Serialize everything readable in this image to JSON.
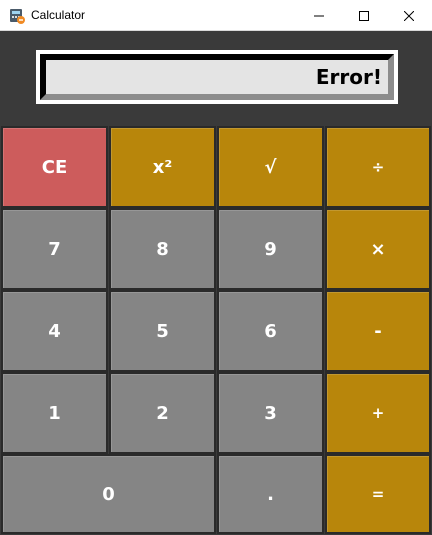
{
  "window": {
    "title": "Calculator",
    "icon": "calculator-app-icon"
  },
  "display": {
    "text": "Error!"
  },
  "colors": {
    "gray": "#858585",
    "gold": "#b8860b",
    "red": "#cd5c5c",
    "background": "#3a3a3a"
  },
  "keys": {
    "ce": "CE",
    "square": "x²",
    "sqrt": "√",
    "divide": "÷",
    "seven": "7",
    "eight": "8",
    "nine": "9",
    "multiply": "×",
    "four": "4",
    "five": "5",
    "six": "6",
    "minus": "-",
    "one": "1",
    "two": "2",
    "three": "3",
    "plus": "+",
    "zero": "0",
    "dot": ".",
    "equals": "="
  }
}
